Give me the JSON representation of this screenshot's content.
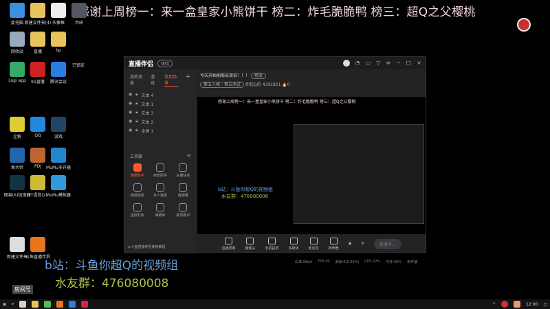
{
  "banner": "感谢上周榜一：来一盒皇家小熊饼干 榜二：炸毛脆脆鸭 榜三：超Q之父樱桃",
  "desktop_icons": [
    {
      "label": "此电脑",
      "color": "#3a8fe0"
    },
    {
      "label": "新建文件夹(4)",
      "color": "#e8c25a"
    },
    {
      "label": "头像框",
      "color": "#eee"
    },
    {
      "label": "共研",
      "color": "#556"
    },
    {
      "label": "回收站",
      "color": "#9ab"
    },
    {
      "label": "直播",
      "color": "#e8c25a"
    },
    {
      "label": "bp",
      "color": "#e8c25a"
    },
    {
      "label": "Logi app",
      "color": "#3a6"
    },
    {
      "label": "91直播",
      "color": "#c22"
    },
    {
      "label": "腾讯会议",
      "color": "#2a7de1"
    },
    {
      "label": "企鹅",
      "color": "#dc3"
    },
    {
      "label": "QQ",
      "color": "#28d"
    },
    {
      "label": "游戏",
      "color": "#246"
    },
    {
      "label": "鱼大师",
      "color": "#26a"
    },
    {
      "label": "PDJ",
      "color": "#b63"
    },
    {
      "label": "MuMu多开器",
      "color": "#28c"
    },
    {
      "label": "网易UU加速器",
      "color": "#134"
    },
    {
      "label": "YY语音(2)",
      "color": "#cb3"
    },
    {
      "label": "MuMu模拟器",
      "color": "#39d"
    },
    {
      "label": "新建文件夹",
      "color": "#ddd"
    },
    {
      "label": "斗鱼直播伴侣",
      "color": "#e8751a"
    }
  ],
  "desktop_extra": {
    "locked": "已锁定",
    "room": "房间号"
  },
  "app": {
    "title": "直播伴侣",
    "badge": "体验",
    "tabs": [
      "我的场景",
      "游戏",
      "常用场景"
    ],
    "layers": [
      "文本 4",
      "文本 1",
      "文本 3",
      "文本 2",
      "全屏 1"
    ],
    "tools_title": "工具箱",
    "tools": [
      "弹幕助手",
      "房管助手",
      "主播任务",
      "视频连麦",
      "多人连麦",
      "截弹幕",
      "虚拟形象",
      "弹幕库",
      "歌词助手"
    ],
    "stream_title": "今天开始刷周末双倍！！！",
    "edit": "修改",
    "category": "第五人格 - 第五测试",
    "room_label": "你超Q的",
    "room_id": "4392821",
    "heat": "0",
    "bottom_tools": [
      "直播屏幕",
      "摄像头",
      "手机投屏",
      "多媒体",
      "麦克风",
      "扬声器"
    ],
    "live_button": "直播中...",
    "tutorial": "斗鱼直播伴侣使用教程",
    "status": [
      "码率:0kb/s",
      "FPS:30",
      "丢帧:0(0.00%)",
      "CPU:22%",
      "内存:40%",
      "未开播"
    ]
  },
  "overlay": {
    "bilibili": "b站：斗鱼你超Q的视频组",
    "qq_group": "水友群：476080008"
  },
  "taskbar": {
    "time": "12:00"
  }
}
